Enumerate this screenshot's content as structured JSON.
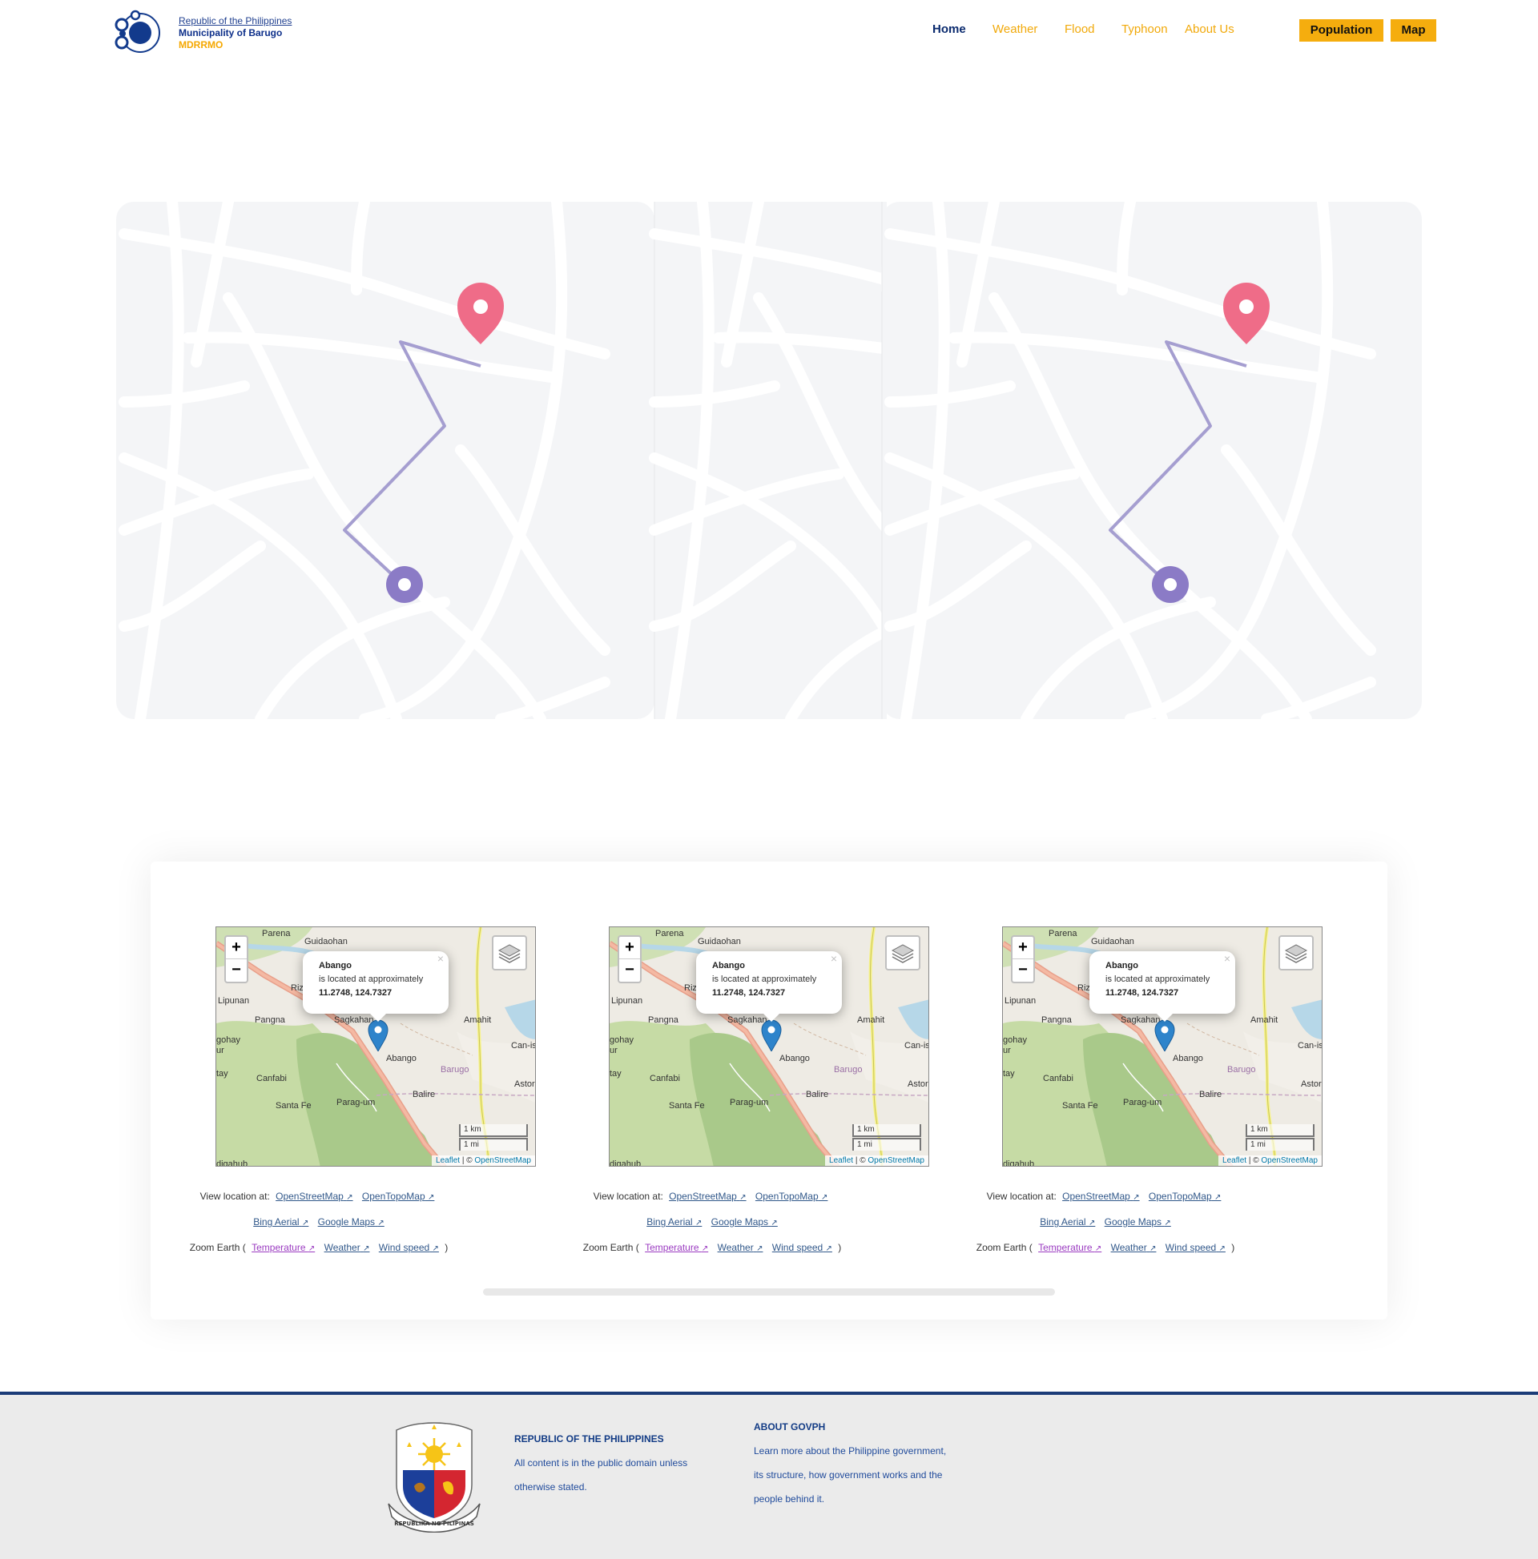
{
  "header": {
    "line1": "Republic of the Philippines",
    "line2": "Municipality of Barugo",
    "line3": "MDRRMO",
    "nav": [
      "Home",
      "Weather",
      "Flood",
      "Typhoon",
      "About Us"
    ],
    "buttons": [
      "Population",
      "Map"
    ]
  },
  "maps": [
    {
      "popup": {
        "place": "Abango",
        "text": "is located at approximately",
        "coords": "11.2748, 124.7327"
      },
      "zoom_in": "+",
      "zoom_out": "−",
      "close": "×",
      "scale_km": "1 km",
      "scale_mi": "1 mi",
      "attrib_leaflet": "Leaflet",
      "attrib_sep": " | © ",
      "attrib_osm": "OpenStreetMap",
      "labels": [
        "Parena",
        "Guidaohan",
        "Lipunan",
        "Pangna",
        "Sagkahan",
        "Amahit",
        "Can-is",
        "Canfabi",
        "Abango",
        "Barugo",
        "Astor",
        "Balire",
        "Santa Fe",
        "Parag-um",
        "gohay",
        "ur",
        "tay",
        "digahub",
        "Riz"
      ],
      "view_label": "View location at:",
      "links": [
        "OpenStreetMap",
        "OpenTopoMap",
        "Bing Aerial",
        "Google Maps"
      ],
      "zoom_earth_label": "Zoom Earth (",
      "zoom_earth_links": [
        "Temperature",
        "Weather",
        "Wind speed"
      ],
      "close_paren": ")"
    },
    {
      "popup": {
        "place": "Abango",
        "text": "is located at approximately",
        "coords": "11.2748, 124.7327"
      },
      "zoom_in": "+",
      "zoom_out": "−",
      "close": "×",
      "scale_km": "1 km",
      "scale_mi": "1 mi",
      "attrib_leaflet": "Leaflet",
      "attrib_sep": " | © ",
      "attrib_osm": "OpenStreetMap",
      "labels": [
        "Parena",
        "Guidaohan",
        "Lipunan",
        "Pangna",
        "Sagkahan",
        "Amahit",
        "Can-is",
        "Canfabi",
        "Abango",
        "Barugo",
        "Astor",
        "Balire",
        "Santa Fe",
        "Parag-um",
        "gohay",
        "ur",
        "tay",
        "digahub",
        "Riz"
      ],
      "view_label": "View location at:",
      "links": [
        "OpenStreetMap",
        "OpenTopoMap",
        "Bing Aerial",
        "Google Maps"
      ],
      "zoom_earth_label": "Zoom Earth (",
      "zoom_earth_links": [
        "Temperature",
        "Weather",
        "Wind speed"
      ],
      "close_paren": ")"
    },
    {
      "popup": {
        "place": "Abango",
        "text": "is located at approximately",
        "coords": "11.2748, 124.7327"
      },
      "zoom_in": "+",
      "zoom_out": "−",
      "close": "×",
      "scale_km": "1 km",
      "scale_mi": "1 mi",
      "attrib_leaflet": "Leaflet",
      "attrib_sep": " | © ",
      "attrib_osm": "OpenStreetMap",
      "labels": [
        "Parena",
        "Guidaohan",
        "Lipunan",
        "Pangna",
        "Sagkahan",
        "Amahit",
        "Can-is",
        "Canfabi",
        "Abango",
        "Barugo",
        "Astor",
        "Balire",
        "Santa Fe",
        "Parag-um",
        "gohay",
        "ur",
        "tay",
        "digahub",
        "Riz"
      ],
      "view_label": "View location at:",
      "links": [
        "OpenStreetMap",
        "OpenTopoMap",
        "Bing Aerial",
        "Google Maps"
      ],
      "zoom_earth_label": "Zoom Earth (",
      "zoom_earth_links": [
        "Temperature",
        "Weather",
        "Wind speed"
      ],
      "close_paren": ")"
    }
  ],
  "footer": {
    "col1_head": "REPUBLIC OF THE PHILIPPINES",
    "col1_l1": "All content is in the public domain unless",
    "col1_l2": "otherwise stated.",
    "col2_head": "ABOUT GOVPH",
    "col2_l1": "Learn more about the Philippine government,",
    "col2_l2": "its structure, how government works and the",
    "col2_l3": "people behind it.",
    "seal_text": "REPUBLIKA NG PILIPINAS"
  },
  "colors": {
    "accent": "#f5ad0e",
    "navy": "#0a2a6e",
    "link": "#31588a",
    "footer_bg": "#ebebeb"
  }
}
